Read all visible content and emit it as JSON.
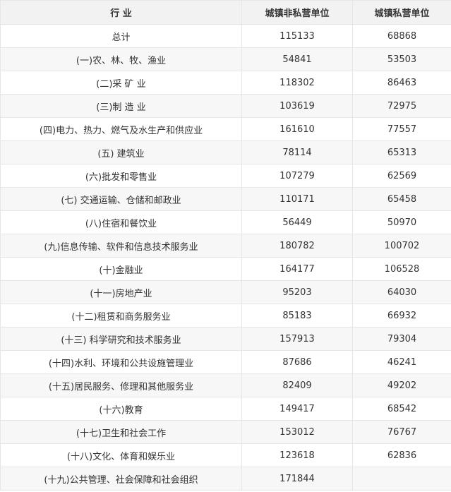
{
  "table": {
    "headers": [
      "行 业",
      "城镇非私营单位",
      "城镇私营单位"
    ],
    "rows": [
      {
        "industry": "总计",
        "non_private": "115133",
        "private": "68868"
      },
      {
        "industry": "(一)农、林、牧、渔业",
        "non_private": "54841",
        "private": "53503"
      },
      {
        "industry": "(二)采 矿 业",
        "non_private": "118302",
        "private": "86463"
      },
      {
        "industry": "(三)制 造 业",
        "non_private": "103619",
        "private": "72975"
      },
      {
        "industry": "(四)电力、热力、燃气及水生产和供应业",
        "non_private": "161610",
        "private": "77557"
      },
      {
        "industry": "(五) 建筑业",
        "non_private": "78114",
        "private": "65313"
      },
      {
        "industry": "(六)批发和零售业",
        "non_private": "107279",
        "private": "62569"
      },
      {
        "industry": "(七) 交通运输、仓储和邮政业",
        "non_private": "110171",
        "private": "65458"
      },
      {
        "industry": "(八)住宿和餐饮业",
        "non_private": "56449",
        "private": "50970"
      },
      {
        "industry": "(九)信息传输、软件和信息技术服务业",
        "non_private": "180782",
        "private": "100702"
      },
      {
        "industry": "(十)金融业",
        "non_private": "164177",
        "private": "106528"
      },
      {
        "industry": "(十一)房地产业",
        "non_private": "95203",
        "private": "64030"
      },
      {
        "industry": "(十二)租赁和商务服务业",
        "non_private": "85183",
        "private": "66932"
      },
      {
        "industry": "(十三) 科学研究和技术服务业",
        "non_private": "157913",
        "private": "79304"
      },
      {
        "industry": "(十四)水利、环境和公共设施管理业",
        "non_private": "87686",
        "private": "46241"
      },
      {
        "industry": "(十五)居民服务、修理和其他服务业",
        "non_private": "82409",
        "private": "49202"
      },
      {
        "industry": "(十六)教育",
        "non_private": "149417",
        "private": "68542"
      },
      {
        "industry": "(十七)卫生和社会工作",
        "non_private": "153012",
        "private": "76767"
      },
      {
        "industry": "(十八)文化、体育和娱乐业",
        "non_private": "123618",
        "private": "62836"
      },
      {
        "industry": "(十九)公共管理、社会保障和社会组织",
        "non_private": "171844",
        "private": ""
      }
    ]
  },
  "colors": {
    "border": "#e6e6e6",
    "header_bg": "#f2f2f2",
    "row_alt_bg": "#f7f7f7",
    "text": "#333333"
  }
}
